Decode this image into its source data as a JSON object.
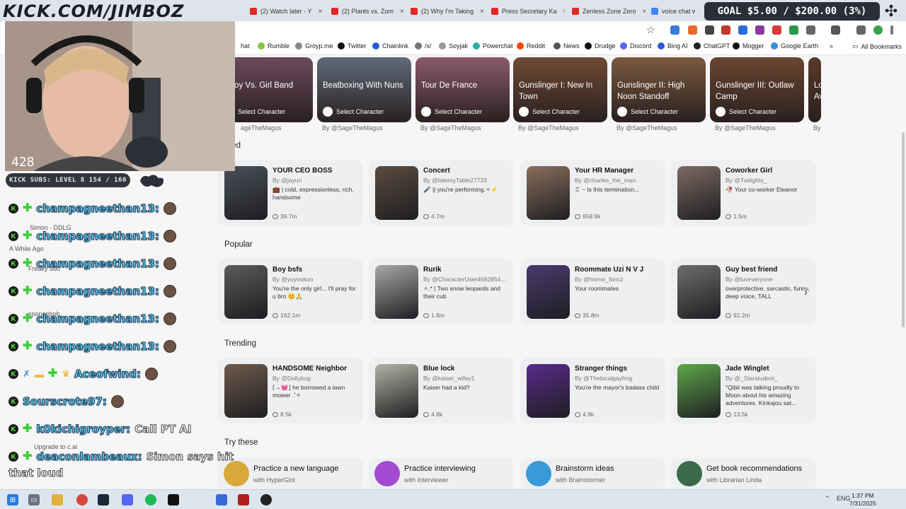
{
  "overlay": {
    "title": "KICK.COM/JIMBOZ",
    "viewer_count": "428",
    "subs_label": "KICK SUBS: LEVEL 8 154 / 160",
    "goal": "GOAL $5.00 / $200.00 (3%)",
    "goal_progress": 0.025
  },
  "tabs": [
    {
      "label": "(2) Watch later - Y",
      "color": "#e02828"
    },
    {
      "label": "(2) Plants vs. Zom",
      "color": "#e02828"
    },
    {
      "label": "(2) Why I'm Taking",
      "color": "#e02828"
    },
    {
      "label": "Press Secretary Ka",
      "color": "#e02828"
    },
    {
      "label": "Zenless Zone Zero",
      "color": "#e02828"
    },
    {
      "label": "voice chat w",
      "color": "#4285f4"
    }
  ],
  "bookmarks": [
    {
      "label": "hat",
      "color": "#888"
    },
    {
      "label": "Rumble",
      "color": "#85c742"
    },
    {
      "label": "Groyp.me",
      "color": "#888"
    },
    {
      "label": "Twitter",
      "color": "#111"
    },
    {
      "label": "Chainlink",
      "color": "#2a5ada"
    },
    {
      "label": "/x/",
      "color": "#777"
    },
    {
      "label": "Soyjak",
      "color": "#999"
    },
    {
      "label": "Powerchat",
      "color": "#2ab0a0"
    },
    {
      "label": "Reddit",
      "color": "#ff4500"
    },
    {
      "label": "News",
      "color": "#555"
    },
    {
      "label": "Drudge",
      "color": "#111"
    },
    {
      "label": "Discord",
      "color": "#5865f2"
    },
    {
      "label": "Bing AI",
      "color": "#2b5cd8"
    },
    {
      "label": "ChatGPT",
      "color": "#222"
    },
    {
      "label": "Mogger",
      "color": "#111"
    },
    {
      "label": "Google Earth",
      "color": "#3a8de0"
    }
  ],
  "all_bookmarks": "All Bookmarks",
  "heroes": [
    {
      "title": ": Boy Vs. Girl Band",
      "select": "Select Character",
      "by": "ageTheMagus",
      "color": "#6b4a5e"
    },
    {
      "title": "Beatboxing With Nuns",
      "select": "Select Character",
      "by": "By @SageTheMagus",
      "color": "#5e6b7a"
    },
    {
      "title": "Tour De France",
      "select": "Select Character",
      "by": "By @SageTheMagus",
      "color": "#8a5b6a"
    },
    {
      "title": "Gunslinger I: New In Town",
      "select": "Select Character",
      "by": "By @SageTheMagus",
      "color": "#6f4a33"
    },
    {
      "title": "Gunslinger II: High Noon Standoff",
      "select": "Select Character",
      "by": "By @SageTheMagus",
      "color": "#7a5a3e"
    },
    {
      "title": "Gunslinger III: Outlaw Camp",
      "select": "Select Character",
      "by": "By @SageTheMagus",
      "color": "#6a4630"
    },
    {
      "title": "Lo Av",
      "select": "",
      "by": "By",
      "color": "#5a3a2a"
    }
  ],
  "sections": {
    "featured": "ured",
    "popular": "Popular",
    "trending": "Trending",
    "try": "Try these"
  },
  "featured": [
    {
      "name": "YOUR CEO BOSS",
      "by": "By @jayuri",
      "desc": "💼 | cold, expressionless, rich, handsome",
      "count": "39.7m",
      "color": "#4a4f58"
    },
    {
      "name": "Concert",
      "by": "By @latemyTable27733",
      "desc": "🎤 || you're performing.✧⚡",
      "count": "4.7m",
      "color": "#5b4b3e"
    },
    {
      "name": "Your HR Manager",
      "by": "By @charles_the_man",
      "desc": "♖ ~ Is this termination...",
      "count": "658.9k",
      "color": "#8a6e5c"
    },
    {
      "name": "Coworker Girl",
      "by": "By @Twilights_",
      "desc": "🥀 Your co-worker Eleanor",
      "count": "1.5m",
      "color": "#7e6a62"
    }
  ],
  "popular": [
    {
      "name": "Boy bsfs",
      "by": "By @yuyookoo",
      "desc": "You're the only girl... I'll pray for u bro 😊🙏",
      "count": "162.1m",
      "color": "#5a5a5a"
    },
    {
      "name": "Rurik",
      "by": "By @CharacterUser4682854...",
      "desc": "✧.* | Two snow leopards and their cub",
      "count": "1.8m",
      "color": "#a8a8a8"
    },
    {
      "name": "Roommate Uzi N V J",
      "by": "By @horror_fancz",
      "desc": "Your roommates",
      "count": "35.8m",
      "color": "#4a3a6e"
    },
    {
      "name": "Guy best friend",
      "by": "By @luveveryone",
      "desc": "overprotective, sarcastic, funny, deep voice, TALL",
      "count": "92.2m",
      "color": "#6e6e6e"
    }
  ],
  "trending": [
    {
      "name": "HANDSOME Neighbor",
      "by": "By @Dollybug",
      "desc": "⌈→💓⌋ he borrowed a lawn mower .˚✧",
      "count": "8.5k",
      "color": "#6e5a4a"
    },
    {
      "name": "Blue lock",
      "by": "By @kaiser_wifey1",
      "desc": "Kaiser had a kid?",
      "count": "4.8k",
      "color": "#b0b4a4"
    },
    {
      "name": "Stranger things",
      "by": "By @Thelocalgayfrog",
      "desc": "You're the mayor's badass child",
      "count": "4.9k",
      "color": "#5a2a8a"
    },
    {
      "name": "Jade Winglet",
      "by": "By @_Starstudent_",
      "desc": "\"Qibli was talking proudly to Moon about his amazing adventures. Kinkajou sat...",
      "count": "13.5k",
      "color": "#5ea84a"
    }
  ],
  "try_these": [
    {
      "line1": "Practice a new language",
      "line2": "with HyperGlot",
      "color": "#d8a83a"
    },
    {
      "line1": "Practice interviewing",
      "line2": "with Interviewer",
      "color": "#a24ad0"
    },
    {
      "line1": "Brainstorm ideas",
      "line2": "with Brainstormer",
      "color": "#3a9ad8"
    },
    {
      "line1": "Get book recommendations",
      "line2": "with Librarian Linda",
      "color": "#3a6a4a"
    }
  ],
  "chat": [
    {
      "user": "champagneethan13:",
      "msg": ""
    },
    {
      "user": "champagneethan13:",
      "msg": ""
    },
    {
      "user": "champagneethan13:",
      "msg": ""
    },
    {
      "user": "champagneethan13:",
      "msg": ""
    },
    {
      "user": "champagneethan13:",
      "msg": ""
    },
    {
      "user": "champagneethan13:",
      "msg": ""
    },
    {
      "user": "Aceofwind:",
      "msg": ""
    },
    {
      "user": "Sourscrote97:",
      "msg": ""
    },
    {
      "user": "k0kichigroyper:",
      "msg": "Call PT AI"
    },
    {
      "user": "deaconlambeaux:",
      "msg": "Simon says hit"
    }
  ],
  "chat_tail": "that loud",
  "faint_sidebar": {
    "simon": "Simon - DDLG",
    "while_ago": "A While Ago",
    "freaky": "Freaky bob",
    "sponge": "spongebob",
    "upgrade": "Upgrade to c.ai"
  },
  "taskbar": {
    "lang": "ENG",
    "time": "1:37 PM",
    "date": "7/31/2025"
  }
}
